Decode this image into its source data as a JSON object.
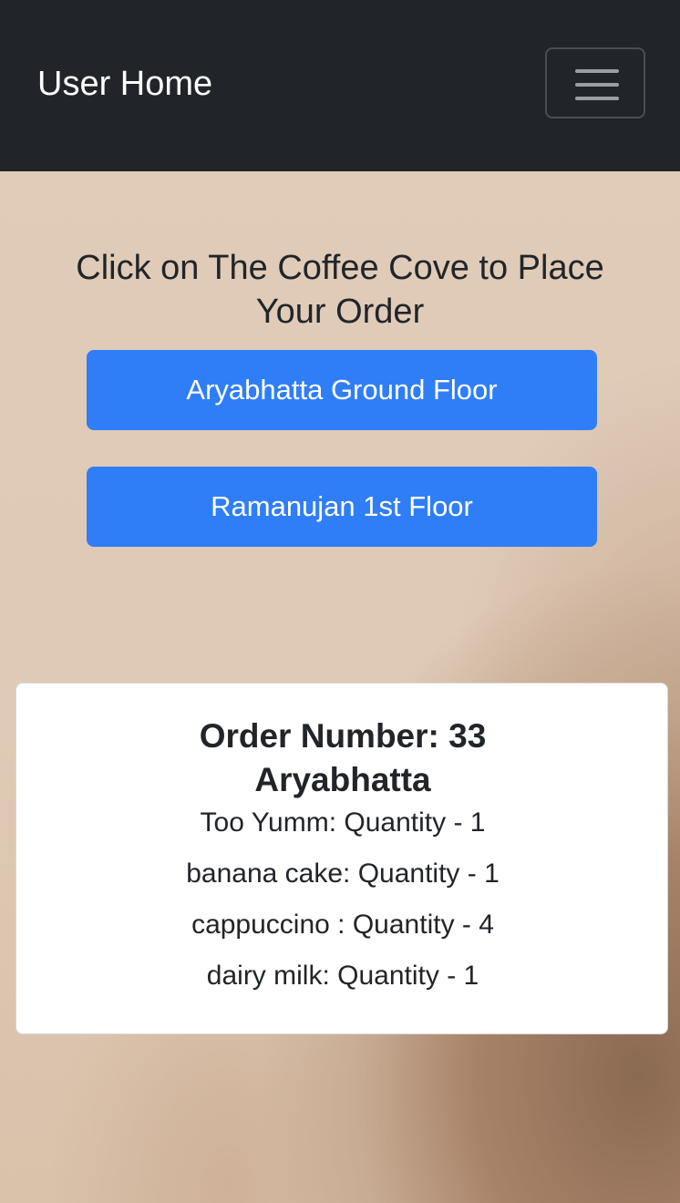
{
  "navbar": {
    "brand": "User Home",
    "toggler_icon": "hamburger-menu-icon"
  },
  "main": {
    "heading": "Click on The Coffee Cove to Place Your Order",
    "locations": [
      {
        "label": "Aryabhatta Ground Floor"
      },
      {
        "label": "Ramanujan 1st Floor"
      }
    ]
  },
  "order": {
    "number_line": "Order Number: 33",
    "location_line": "Aryabhatta",
    "items": [
      {
        "text": "Too Yumm: Quantity - 1"
      },
      {
        "text": "banana cake: Quantity - 1"
      },
      {
        "text": "cappuccino : Quantity - 4"
      },
      {
        "text": "dairy milk: Quantity - 1"
      }
    ]
  },
  "colors": {
    "navbar_bg": "#212529",
    "button_bg": "#2f7ef7",
    "page_bg": "#e1cdba"
  }
}
